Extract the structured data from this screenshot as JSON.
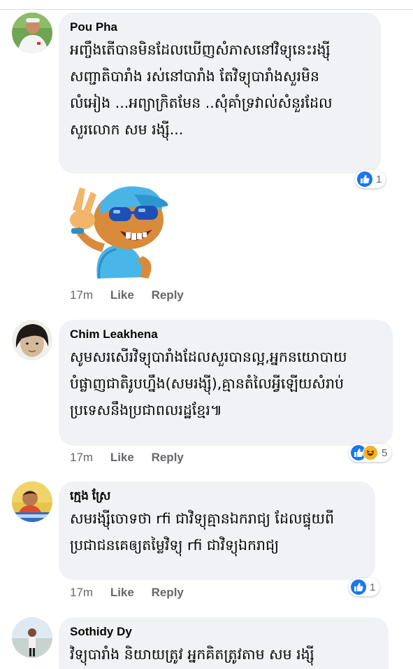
{
  "comments": [
    {
      "name": "Pou Pha",
      "text": "អញ្ចឹងតើបានមិនដែលឃើញសំភាសនៅវិទ្យុនេះរង្ស៊ី\nសញ្ជាតិបារាំង រស់នៅបារាំង តែវិទ្យុបារាំងសួរមិន\nលំអៀង ...អព្យាក្រិតមែន ..សុំគាំទ្រវាល់់សំនួរដែល\nសួរលោក សម រង្ស៊ី...",
      "reaction_count": "1",
      "time": "17m",
      "like_label": "Like",
      "reply_label": "Reply",
      "has_sticker": true
    },
    {
      "name": "Chim Leakhena",
      "text": "សូមសរសើរវិទ្យុបារាំងដែលសួរបានល្អ,អ្នកនយោបាយ\nបំផ្លាញជាតិរូបហ្នឹង(សមរង្ស៊ី),គ្មានតំលៃអ្វីឡើយសំរាប់\nប្រទេសនឹងប្រជាពលរដ្ឋខ្មែរ៕",
      "reaction_count": "5",
      "time": "17m",
      "like_label": "Like",
      "reply_label": "Reply"
    },
    {
      "name": "ក្មេង ស្រែ",
      "text": "សមរង្ស៊ីចោទថា rfi ជាវិទ្យុគ្មានឯករាជ្យ ដែលផ្ទុយពី\nប្រជាជនគេឲ្យតម្លៃវិទ្យុ rfi ជាវិទ្យុឯករាជ្យ",
      "reaction_count": "1",
      "time": "17m",
      "like_label": "Like",
      "reply_label": "Reply"
    },
    {
      "name": "Sothidy Dy",
      "text": "វិទ្យុបារាំង និយាយត្រូវ អ្នកគិតត្រូវតាម សម រង្ស៊ី"
    }
  ],
  "colors": {
    "bubble": "#f0f2f5",
    "meta_text": "#65676b",
    "like_blue": "#1877f2",
    "haha_yellow": "#f7b125"
  },
  "icons": [
    "like-reaction-icon",
    "haha-reaction-icon",
    "sticker-thumbs-peace"
  ]
}
